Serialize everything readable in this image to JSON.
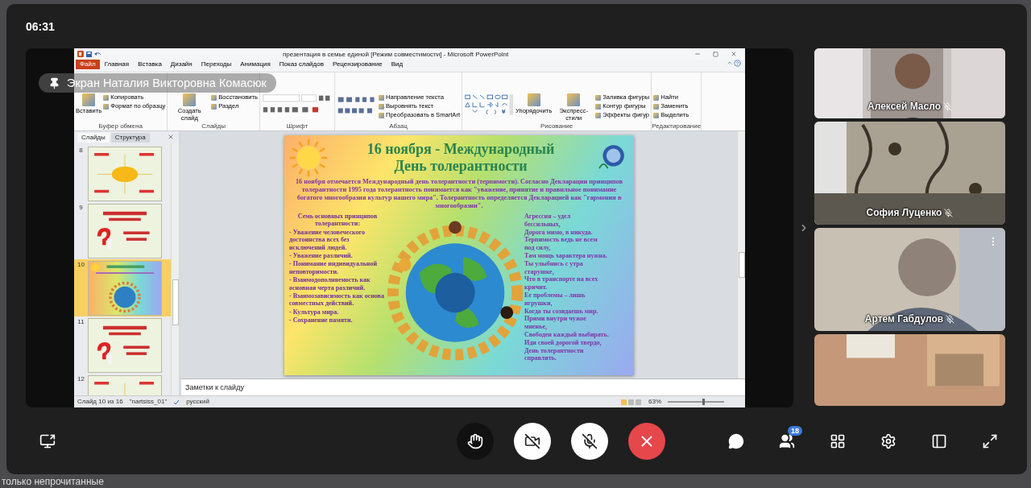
{
  "call": {
    "timer": "06:31"
  },
  "screen_share": {
    "presenter_label": "Экран Наталия Викторовна Комасюк"
  },
  "app": {
    "title": "презентация в семье единой [Режим совместимости] - Microsoft PowerPoint",
    "ribbon_tabs": [
      {
        "label": "Файл",
        "selected": true
      },
      {
        "label": "Главная",
        "selected": false
      },
      {
        "label": "Вставка",
        "selected": false
      },
      {
        "label": "Дизайн",
        "selected": false
      },
      {
        "label": "Переходы",
        "selected": false
      },
      {
        "label": "Анимация",
        "selected": false
      },
      {
        "label": "Показ слайдов",
        "selected": false
      },
      {
        "label": "Рецензирование",
        "selected": false
      },
      {
        "label": "Вид",
        "selected": false
      }
    ],
    "ribbon_groups": [
      {
        "label": "Буфер обмена",
        "kind": "commands",
        "commands": [
          {
            "label": "Вставить",
            "kind": "large"
          },
          {
            "label": "Копировать",
            "kind": "small"
          },
          {
            "label": "Формат по образцу",
            "kind": "small"
          }
        ]
      },
      {
        "label": "Слайды",
        "kind": "commands",
        "commands": [
          {
            "label": "Создать слайд",
            "kind": "large"
          },
          {
            "label": "Восстановить",
            "kind": "small"
          },
          {
            "label": "Раздел",
            "kind": "small"
          }
        ]
      },
      {
        "label": "Шрифт",
        "kind": "font"
      },
      {
        "label": "Абзац",
        "kind": "paragraph",
        "commands": [
          {
            "label": "Направление текста",
            "kind": "small"
          },
          {
            "label": "Выровнять текст",
            "kind": "small"
          },
          {
            "label": "Преобразовать в SmartArt",
            "kind": "small"
          }
        ]
      },
      {
        "label": "Рисование",
        "kind": "shapes",
        "commands": [
          {
            "label": "Упорядочить",
            "kind": "large"
          },
          {
            "label": "Экспресс-стили",
            "kind": "large"
          },
          {
            "label": "Заливка фигуры",
            "kind": "small"
          },
          {
            "label": "Контур фигуры",
            "kind": "small"
          },
          {
            "label": "Эффекты фигур",
            "kind": "small"
          }
        ]
      },
      {
        "label": "Редактирование",
        "kind": "commands",
        "commands": [
          {
            "label": "Найти",
            "kind": "small"
          },
          {
            "label": "Заменить",
            "kind": "small"
          },
          {
            "label": "Выделить",
            "kind": "small"
          }
        ]
      }
    ],
    "panel_tabs": [
      {
        "label": "Слайды",
        "selected": true
      },
      {
        "label": "Структура",
        "selected": false
      }
    ],
    "thumbnails": [
      {
        "number": "8",
        "selected": false,
        "kind": "diagram"
      },
      {
        "number": "9",
        "selected": false,
        "kind": "question"
      },
      {
        "number": "10",
        "selected": true,
        "kind": "rainbow"
      },
      {
        "number": "11",
        "selected": false,
        "kind": "question"
      },
      {
        "number": "12",
        "selected": false,
        "kind": "diagram"
      }
    ],
    "slide": {
      "title_lines": [
        "16 ноября - Международный",
        "День толерантности"
      ],
      "intro": "16 ноября отмечается Международный день толерантности (терпимости). Согласно Декларации принципов толерантности 1995 года толерантность понимается как \"уважение, принятие и правильное понимание богатого многообразия культур нашего мира\". Толерантность определяется Декларацией как \"гармония в многообразии\".",
      "principles_heading": "Семь основных принципов толерантности:",
      "principles": [
        "- Уважение человеческого достоинства всех без исключений людей.",
        "- Уважение различий.",
        "- Понимание индивидуальной неповторимости.",
        "- Взаимодополняемость как основная черта различий.",
        "- Взаимозависимость как основа совместных действий.",
        "- Культура мира.",
        "- Сохранение памяти."
      ],
      "poem_lines": [
        "Агрессия – удел",
        "бессильных,",
        "Дорога мимо, в никуда.",
        "Терпимость ведь не всем",
        "под силу,",
        "Там мощь характера нужна.",
        "Ты улыбнись с утра",
        "старушке,",
        "Что в транспорте на всех",
        "кричит.",
        "Ее проблемы – лишь",
        "игрушки,",
        "Когда ты созидаешь мир.",
        "Прими внутри чужое",
        "мненье,",
        "Свободен каждый выбирать.",
        "Иди своей дорогой твердо,",
        "День толерантности",
        "справлять."
      ]
    },
    "notes_placeholder": "Заметки к слайду",
    "status": {
      "slide": "Слайд 10 из 16",
      "theme": "\"nartsiss_01\"",
      "language": "русский",
      "zoom": "63%"
    },
    "zoom_slider": {
      "level": 0.62
    }
  },
  "participants": [
    {
      "name": "Алексей Масло",
      "muted": true,
      "show_menu": false
    },
    {
      "name": "София Луценко",
      "muted": true,
      "show_menu": false
    },
    {
      "name": "Артем Габдулов",
      "muted": true,
      "show_menu": true
    },
    {
      "kind": "picture"
    }
  ],
  "controls": {
    "camera_on": false,
    "mic_on": false,
    "participants_count": "18"
  },
  "background_text": "только непрочитанные"
}
